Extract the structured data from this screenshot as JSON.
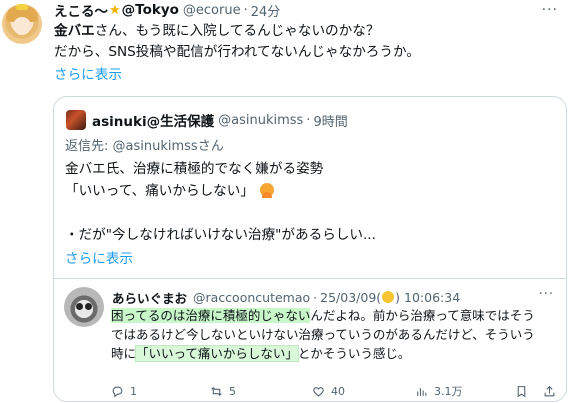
{
  "tweet": {
    "display_name_1": "えこる〜",
    "display_name_2": "@Tokyo",
    "handle": "@ecorue",
    "separator": "·",
    "time": "24分",
    "line1_bold": "金バエ",
    "line1_rest": "さん、もう既に入院してるんじゃないのかな？",
    "line2": "だから、SNS投稿や配信が行われてないんじゃなかろうか。",
    "show_more": "さらに表示",
    "more_icon": "more-icon"
  },
  "quote": {
    "name": "asinuki@生活保護",
    "handle": "@asinukimss",
    "separator": "·",
    "time": "9時間",
    "reply_to": "返信先: @asinukimssさん",
    "line1": "金バエ氏、治療に積極的でなく嫌がる姿勢",
    "line2": "「いいって、痛いからしない」",
    "line3": "・だが\"今しなければいけない治療\"があるらしい...",
    "show_more": "さらに表示"
  },
  "inner": {
    "name": "あらいぐまお",
    "handle": "@raccooncutemao",
    "separator": "·",
    "date_a": "25/03/09(",
    "date_b": ") 10:06:34",
    "line1_hl": "困ってるのは治療に積極的じゃない",
    "line1_rest": "んだよね。前から治療って意味ではそう",
    "line2": "ではあるけど今しないといけない治療っていうのがあるんだけど、そういう",
    "line3_a": "時に",
    "line3_hl": "「いいって痛いからしない」",
    "line3_b": "とかそういう感じ。",
    "actions": {
      "reply_count": "1",
      "retweet_count": "5",
      "like_count": "40",
      "view_count": "3.1万"
    }
  },
  "colors": {
    "link": "#1d9bf0",
    "muted": "#536471",
    "highlight": "#c9f7c9",
    "border": "#cfd9de"
  }
}
